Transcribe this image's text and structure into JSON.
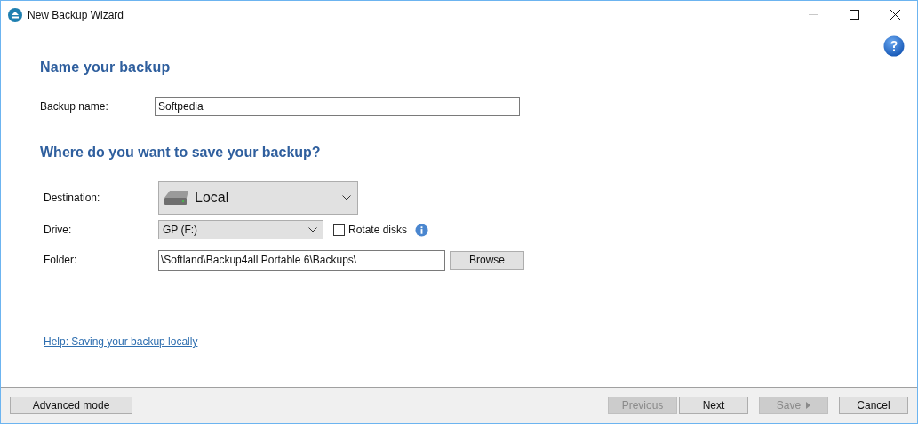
{
  "window": {
    "title": "New Backup Wizard",
    "controls": [
      {
        "kind": "minimize",
        "disabled": true
      },
      {
        "kind": "maximize",
        "disabled": false
      },
      {
        "kind": "close",
        "disabled": false
      }
    ]
  },
  "sections": [
    {
      "title": "Name your backup"
    },
    {
      "title": "Where do you want to save your backup?"
    }
  ],
  "backup_name": {
    "label": "Backup name:",
    "value": "Softpedia"
  },
  "destination": {
    "label": "Destination:",
    "value": "Local"
  },
  "drive": {
    "label": "Drive:",
    "value": "GP (F:)"
  },
  "rotate_disks": {
    "label": "Rotate disks",
    "checked": false
  },
  "folder": {
    "label": "Folder:",
    "value": "\\Softland\\Backup4all Portable 6\\Backups\\",
    "button": "Browse"
  },
  "help_link": "Help: Saving your backup locally",
  "footer": {
    "left": {
      "label": "Advanced mode",
      "disabled": false
    },
    "buttons": [
      {
        "label": "Previous",
        "disabled": true,
        "arrow": false
      },
      {
        "label": "Next",
        "disabled": false,
        "arrow": false
      },
      {
        "label": "Save",
        "disabled": true,
        "arrow": true
      },
      {
        "label": "Cancel",
        "disabled": false,
        "arrow": false
      }
    ]
  }
}
